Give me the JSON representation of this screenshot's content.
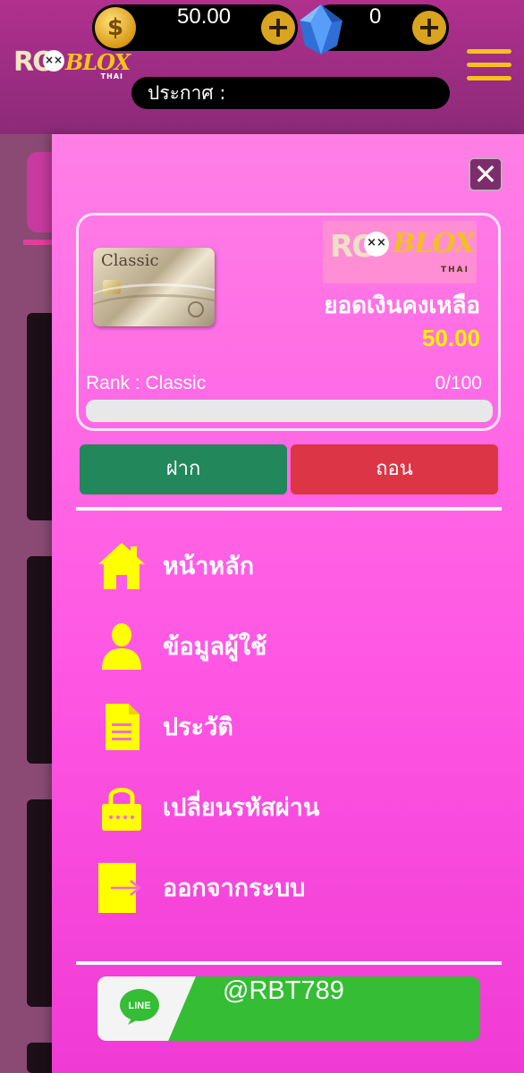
{
  "header": {
    "logo": {
      "ro": "RO",
      "blox": "BLOX",
      "thai": "THAI"
    },
    "money_balance": "50.00",
    "gem_balance": "0",
    "plus_symbol": "+",
    "coin_symbol": "$",
    "announcement_label": "ประกาศ :"
  },
  "drawer": {
    "close_symbol": "✕",
    "card": {
      "card_name": "Classic",
      "logo": {
        "ro": "RO",
        "blox": "BLOX",
        "thai": "THAI"
      },
      "balance_label": "ยอดเงินคงเหลือ",
      "balance_value": "50.00",
      "rank_label": "Rank : Classic",
      "rank_progress_text": "0/100",
      "rank_progress_fraction": 0.0
    },
    "buttons": {
      "deposit_label": "ฝาก",
      "withdraw_label": "ถอน"
    },
    "menu": [
      {
        "label": "หน้าหลัก",
        "icon": "home-icon"
      },
      {
        "label": "ข้อมูลผู้ใช้",
        "icon": "user-icon"
      },
      {
        "label": "ประวัติ",
        "icon": "document-icon"
      },
      {
        "label": "เปลี่ยนรหัสผ่าน",
        "icon": "lock-icon"
      },
      {
        "label": "ออกจากระบบ",
        "icon": "logout-icon"
      }
    ],
    "line_contact": {
      "logo_text": "LINE",
      "id": "@RBT789"
    }
  },
  "colors": {
    "drawer_top": "#ff7fe6",
    "drawer_bottom": "#f03ad4",
    "icon_yellow": "#ffff00",
    "deposit_green": "#22875a",
    "withdraw_red": "#dc3545",
    "balance_yellow": "#fff200",
    "line_green": "#35bd35"
  }
}
